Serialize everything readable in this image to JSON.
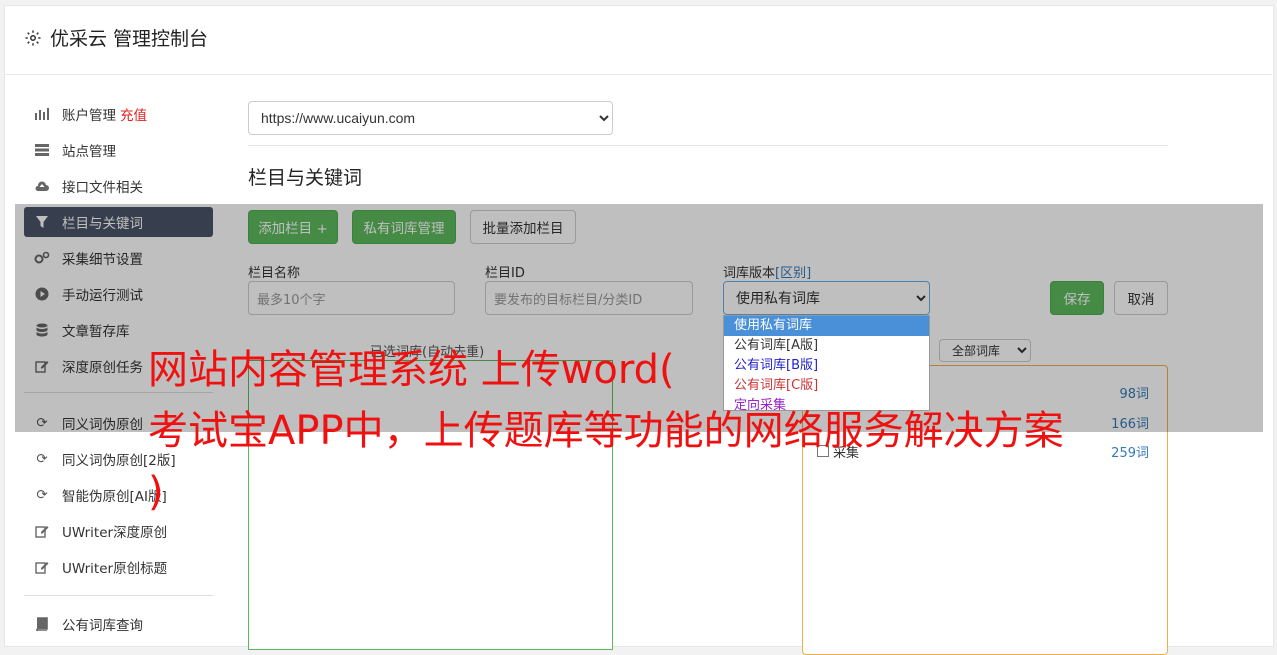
{
  "header": {
    "title": "优采云 管理控制台",
    "icon": "gear-icon"
  },
  "sidebar": {
    "items": [
      {
        "label": "账户管理",
        "badge": "充值",
        "icon": "bar-chart-icon"
      },
      {
        "label": "站点管理",
        "icon": "server-icon"
      },
      {
        "label": "接口文件相关",
        "icon": "cloud-upload-icon"
      },
      {
        "label": "栏目与关键词",
        "icon": "filter-icon",
        "active": true
      },
      {
        "label": "采集细节设置",
        "icon": "gears-icon"
      },
      {
        "label": "手动运行测试",
        "icon": "play-circle-icon"
      },
      {
        "label": "文章暂存库",
        "icon": "database-icon"
      },
      {
        "label": "深度原创任务",
        "icon": "edit-icon"
      },
      {
        "label": "同义词伪原创",
        "icon": "refresh-icon"
      },
      {
        "label": "同义词伪原创[2版]",
        "icon": "refresh-icon"
      },
      {
        "label": "智能伪原创[AI版]",
        "icon": "refresh-icon"
      },
      {
        "label": "UWriter深度原创",
        "icon": "edit-icon"
      },
      {
        "label": "UWriter原创标题",
        "icon": "edit-icon"
      },
      {
        "label": "公有词库查询",
        "icon": "book-icon"
      }
    ]
  },
  "main": {
    "site_select": "https://www.ucaiyun.com",
    "section_title": "栏目与关键词",
    "buttons": {
      "add_column": "添加栏目 +",
      "private_lib": "私有词库管理",
      "batch_add": "批量添加栏目",
      "save": "保存",
      "cancel": "取消"
    },
    "form": {
      "name_label": "栏目名称",
      "name_placeholder": "最多10个字",
      "id_label": "栏目ID",
      "id_placeholder": "要发布的目标栏目/分类ID",
      "version_label": "词库版本",
      "version_link": "[区别]",
      "version_value": "使用私有词库"
    },
    "dropdown": {
      "options": [
        {
          "label": "使用私有词库",
          "color": "#ffffff",
          "bg": "#1e90ff"
        },
        {
          "label": "公有词库[A版]",
          "color": "#333333"
        },
        {
          "label": "公有词库[B版]",
          "color": "#2222cc"
        },
        {
          "label": "公有词库[C版]",
          "color": "#cc3333"
        },
        {
          "label": "定向采集",
          "color": "#9922cc"
        }
      ]
    },
    "left_panel_label": "已选词库(自动去重)",
    "all_select": "全部词库",
    "right_panel_rows": [
      {
        "label": "",
        "count": "98词"
      },
      {
        "label": "",
        "count": "166词"
      },
      {
        "label": "采集",
        "count": "259词"
      }
    ]
  },
  "overlay": {
    "line1": "网站内容管理系统 上传word(",
    "line2": "考试宝APP中，上传题库等功能的网络服务解决方案",
    "line3": ")"
  }
}
